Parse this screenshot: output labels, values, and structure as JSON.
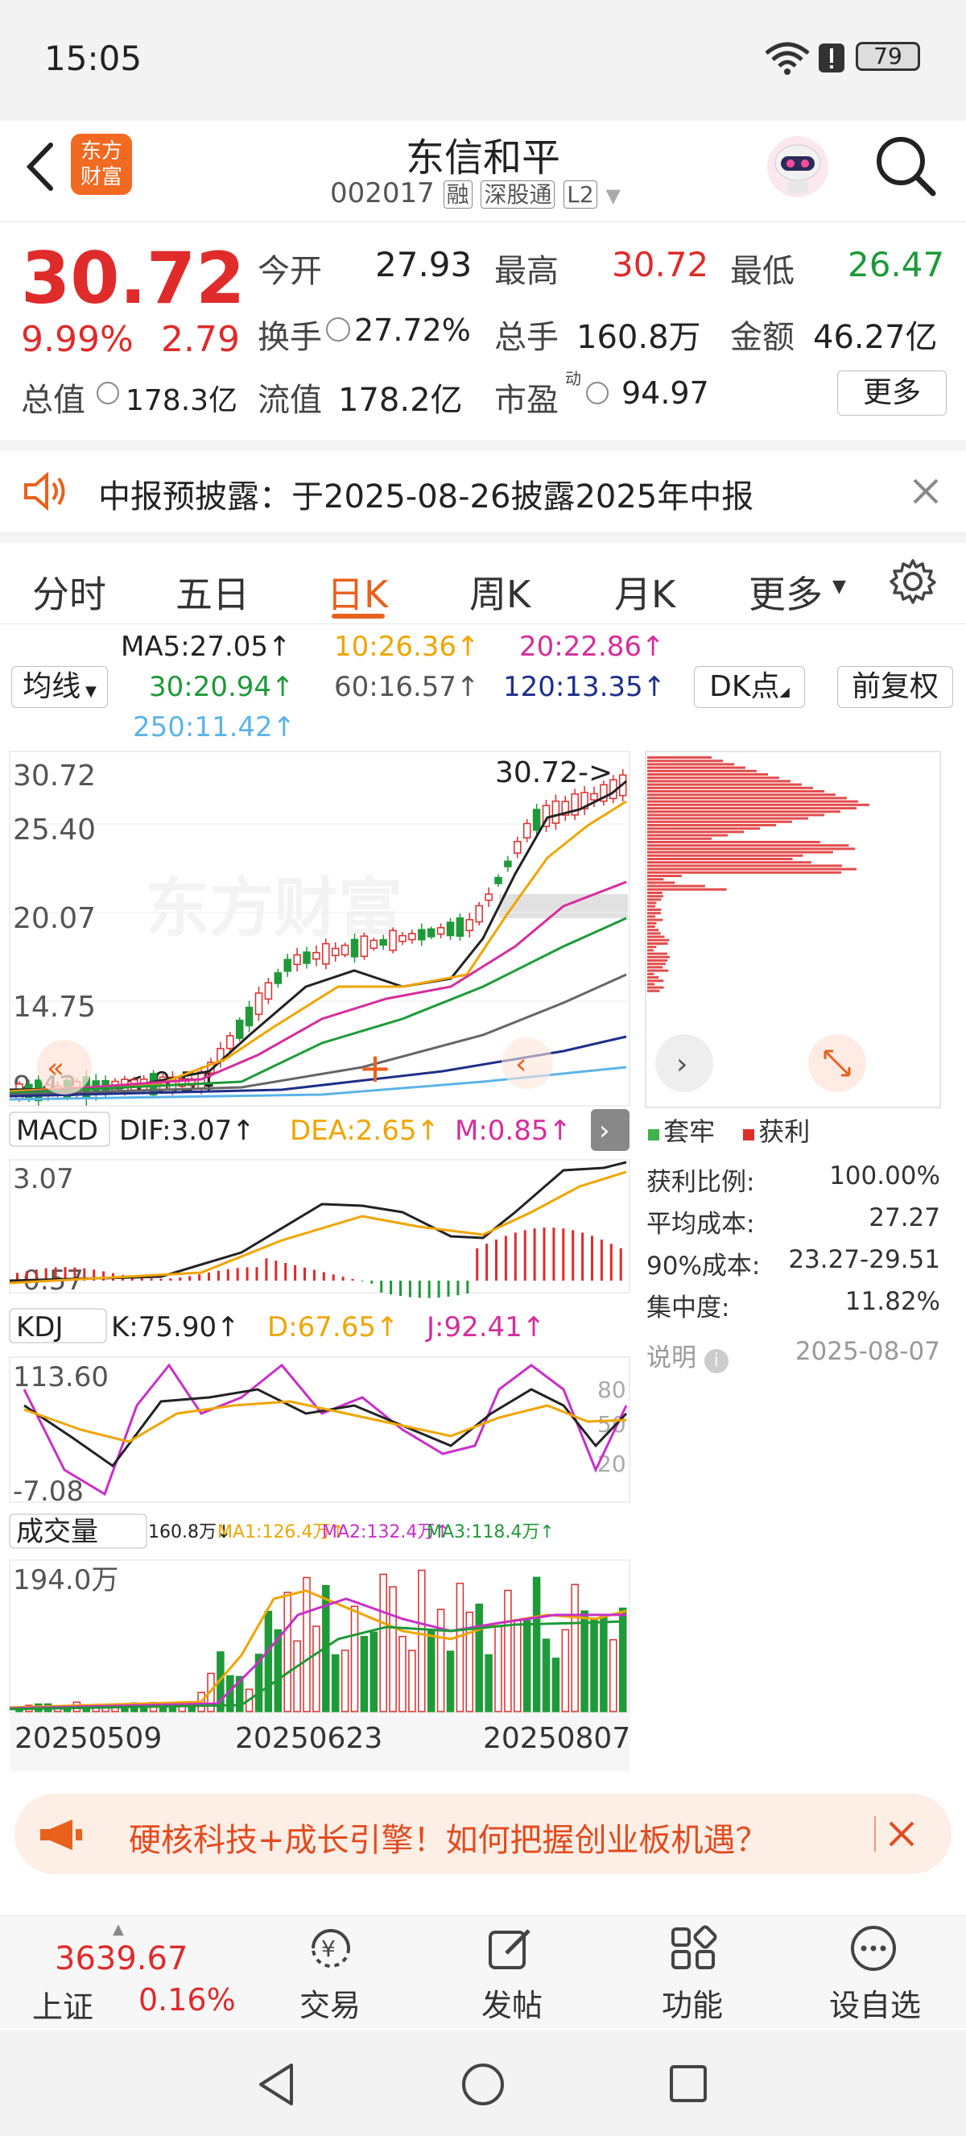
{
  "status_bar": {
    "time": "15:05",
    "battery": "79"
  },
  "header": {
    "title": "东信和平",
    "code": "002017",
    "badge_rong": "融",
    "badge_sgt": "深股通",
    "badge_l2": "L2",
    "logo_top": "东方",
    "logo_bottom": "财富"
  },
  "quote": {
    "price": "30.72",
    "change_pct": "9.99%",
    "change_amt": "2.79",
    "open_label": "今开",
    "open": "27.93",
    "high_label": "最高",
    "high": "30.72",
    "low_label": "最低",
    "low": "26.47",
    "turnover_label": "换手",
    "turnover": "27.72%",
    "volume_label": "总手",
    "volume": "160.8万",
    "amount_label": "金额",
    "amount": "46.27亿",
    "mktcap_label": "总值",
    "mktcap": "178.3亿",
    "float_label": "流值",
    "float": "178.2亿",
    "pe_label": "市盈",
    "pe_sup": "动",
    "pe": "94.97",
    "more": "更多"
  },
  "notice": {
    "text": "中报预披露：于2025-08-26披露2025年中报"
  },
  "tabs": [
    "分时",
    "五日",
    "日K",
    "周K",
    "月K",
    "更多"
  ],
  "ma": {
    "selector": "均线",
    "ma5": "MA5:27.05↑",
    "ma10": "10:26.36↑",
    "ma20": "20:22.86↑",
    "ma30": "30:20.94↑",
    "ma60": "60:16.57↑",
    "ma120": "120:13.35↑",
    "ma250": "250:11.42↑",
    "dk": "DK点",
    "fq": "前复权"
  },
  "kline": {
    "y_labels": [
      "30.72",
      "25.40",
      "20.07",
      "14.75",
      "9.42"
    ],
    "high_marker": "30.72->",
    "low_marker": "<-9.54",
    "watermark": "东方财富"
  },
  "macd": {
    "selector": "MACD",
    "dif": "DIF:3.07↑",
    "dea": "DEA:2.65↑",
    "m": "M:0.85↑",
    "ymax": "3.07",
    "ymin": "-0.57"
  },
  "kdj": {
    "selector": "KDJ",
    "k": "K:75.90↑",
    "d": "D:67.65↑",
    "j": "J:92.41↑",
    "ymax": "113.60",
    "ymin": "-7.08",
    "l80": "80",
    "l50": "50",
    "l20": "20"
  },
  "vol": {
    "selector": "成交量",
    "v": "160.8万↓",
    "ma1": "MA1:126.4万↑",
    "ma2": "MA2:132.4万↑",
    "ma3": "MA3:118.4万↑",
    "ymax": "194.0万"
  },
  "dates": [
    "20250509",
    "20250623",
    "20250807"
  ],
  "chip": {
    "legend_trapped": "套牢",
    "legend_profit": "获利",
    "rows": [
      {
        "label": "获利比例:",
        "value": "100.00%"
      },
      {
        "label": "平均成本:",
        "value": "27.27"
      },
      {
        "label": "90%成本:",
        "value": "23.27-29.51"
      },
      {
        "label": "集中度:",
        "value": "11.82%"
      }
    ],
    "note_label": "说明",
    "note_date": "2025-08-07"
  },
  "ad": {
    "text": "硬核科技+成长引擎！如何把握创业板机遇？"
  },
  "bottom_nav": {
    "index_value": "3639.67",
    "index_name": "上证",
    "index_pct": "0.16%",
    "items": [
      "交易",
      "发帖",
      "功能",
      "设自选"
    ]
  },
  "colors": {
    "accent": "#e8611d",
    "up": "#e02b2b",
    "down": "#1e9a38"
  }
}
